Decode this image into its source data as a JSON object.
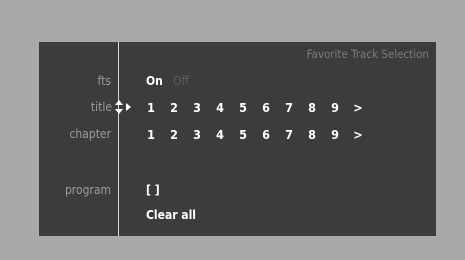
{
  "header": {
    "title": "Favorite Track Selection"
  },
  "rows": {
    "fts": {
      "label": "fts",
      "on": "On",
      "off": "Off"
    },
    "title": {
      "label": "title",
      "numbers": [
        "1",
        "2",
        "3",
        "4",
        "5",
        "6",
        "7",
        "8",
        "9"
      ],
      "more": ">"
    },
    "chapter": {
      "label": "chapter",
      "numbers": [
        "1",
        "2",
        "3",
        "4",
        "5",
        "6",
        "7",
        "8",
        "9"
      ],
      "more": ">"
    },
    "program": {
      "label": "program",
      "value": "[ ]",
      "clear": "Clear all"
    }
  },
  "colors": {
    "background": "#a9a9a9",
    "panel": "#3c3c3c",
    "label": "#9c9c9c",
    "active": "#ffffff",
    "inactive": "#5e5e5e"
  },
  "icons": {
    "selection_cursor": "updown-right-arrow-icon"
  }
}
